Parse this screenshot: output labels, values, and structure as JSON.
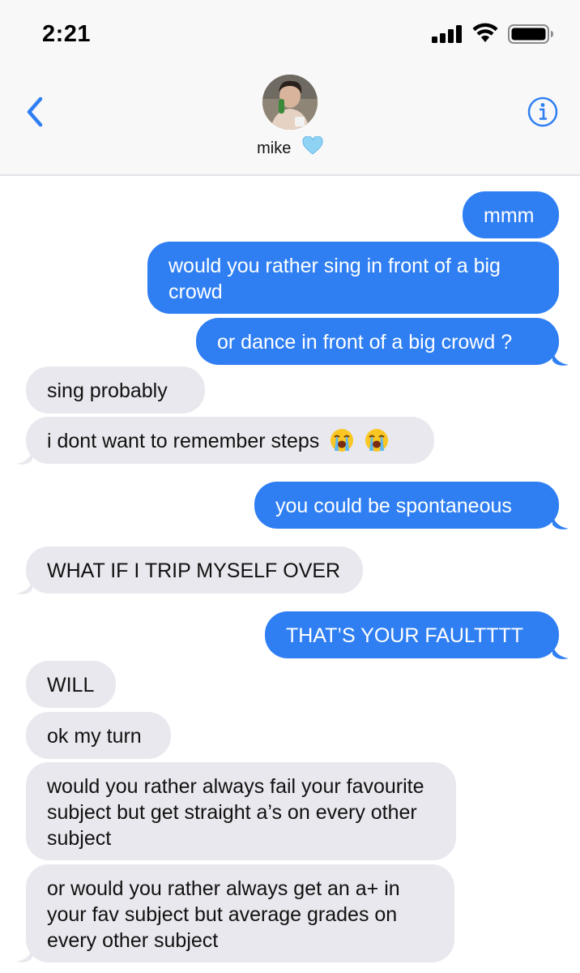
{
  "status_bar": {
    "time": "2:21",
    "signal_icon": "cellular-signal-icon",
    "wifi_icon": "wifi-icon",
    "battery_icon": "battery-icon"
  },
  "header": {
    "contact_name": "mike",
    "contact_emoji": "light-blue-heart-icon",
    "back_icon": "chevron-left-icon",
    "info_icon": "info-icon",
    "accent_color": "#2f7ff3"
  },
  "colors": {
    "outgoing_bubble": "#2f7ff3",
    "incoming_bubble": "#e9e8ee"
  },
  "messages": [
    {
      "side": "out",
      "text": "mmm"
    },
    {
      "side": "out",
      "text": "would you rather sing in front of a big crowd"
    },
    {
      "side": "out",
      "text": "or dance in front of a big crowd ?"
    },
    {
      "side": "in",
      "text": "sing probably"
    },
    {
      "side": "in",
      "text": "i dont want to remember steps",
      "emoji": [
        "loudly-crying-face-icon",
        "loudly-crying-face-icon"
      ]
    },
    {
      "side": "out",
      "text": "you could be spontaneous"
    },
    {
      "side": "in",
      "text": "WHAT IF I TRIP MYSELF OVER"
    },
    {
      "side": "out",
      "text": "THAT’S YOUR FAULTTTT"
    },
    {
      "side": "in",
      "text": "WILL"
    },
    {
      "side": "in",
      "text": "ok my turn"
    },
    {
      "side": "in",
      "text": "would you rather always fail your favourite subject but get straight a’s on every other subject"
    },
    {
      "side": "in",
      "text": "or would you rather always get an a+ in your fav subject but average grades on every other subject"
    }
  ]
}
